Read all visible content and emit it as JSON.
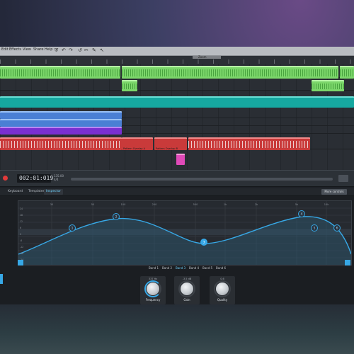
{
  "menu": {
    "items": [
      "Edit",
      "Effects",
      "View",
      "Share",
      "Help"
    ],
    "tools": [
      "pointer-icon",
      "undo-icon",
      "redo-icon",
      "scissors-icon",
      "draw-icon"
    ]
  },
  "ruler": {
    "region_label": "Zoom",
    "marks": [
      "1",
      "9",
      "17",
      "25",
      "33",
      "41",
      "49",
      "57",
      "65",
      "73",
      "81",
      "89",
      "97",
      "105",
      "113",
      "121",
      "129",
      "137",
      "145",
      "153",
      "161",
      "169",
      "177"
    ]
  },
  "tracks": {
    "pattern_clip_a": "Pattern Overlap A",
    "pattern_clip_b": "Pattern Overlap B"
  },
  "transport": {
    "time": "002:01:019",
    "info_top": "135.00",
    "info_bottom": "4/4"
  },
  "tabs": {
    "items": [
      "Keyboard",
      "Templates",
      "Inspector"
    ],
    "active": "Inspector",
    "more_label": "More controls"
  },
  "eq": {
    "freq_labels": [
      "30",
      "50",
      "100",
      "200",
      "500",
      "1k",
      "2k",
      "5k",
      "10k"
    ],
    "db_labels": [
      "24",
      "18",
      "12",
      "6",
      "0",
      "-6",
      "-12",
      "-18",
      "-24"
    ],
    "bands": [
      "Band 1",
      "Band 2",
      "Band 3",
      "Band 4",
      "Band 5",
      "Band 6"
    ],
    "active_band": "Band 3",
    "nodes": [
      "1",
      "2",
      "3",
      "4",
      "5",
      "6"
    ]
  },
  "knobs": [
    {
      "label": "Frequency",
      "value": "337 Hz"
    },
    {
      "label": "Gain",
      "value": "-3.5 dB"
    },
    {
      "label": "Quality",
      "value": "0.6"
    }
  ],
  "colors": {
    "accent": "#37a8e6",
    "record": "#e23a3a",
    "track_green": "#7bd66a",
    "track_teal": "#16a8a0",
    "track_blue": "#4a7fd4",
    "track_purple": "#7a2fd1",
    "track_red": "#c93a3a",
    "track_pink": "#e04ab8"
  }
}
